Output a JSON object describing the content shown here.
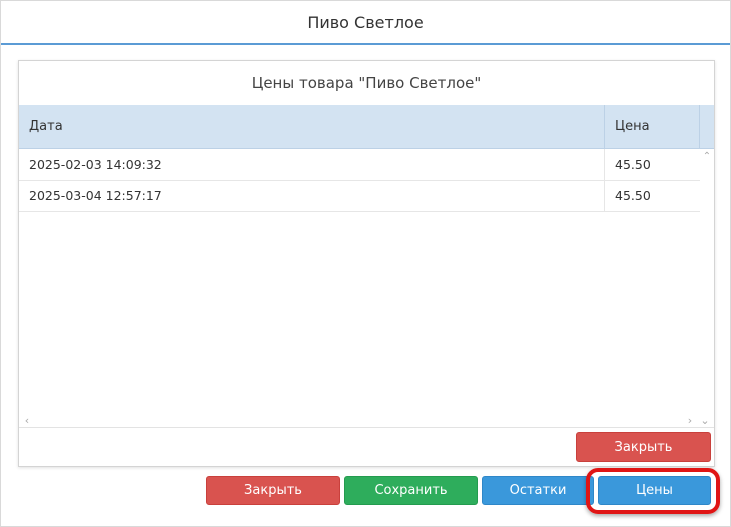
{
  "window": {
    "title": "Пиво Светлое"
  },
  "panel": {
    "title": "Цены товара \"Пиво Светлое\"",
    "columns": [
      "Дата",
      "Цена"
    ],
    "rows": [
      {
        "date": "2025-02-03 14:09:32",
        "price": "45.50"
      },
      {
        "date": "2025-03-04 12:57:17",
        "price": "45.50"
      }
    ],
    "close_label": "Закрыть"
  },
  "footer": {
    "close_label": "Закрыть",
    "save_label": "Сохранить",
    "stock_label": "Остатки",
    "prices_label": "Цены"
  },
  "colors": {
    "accent": "#5b9bd5",
    "header_bg": "#d3e3f2",
    "red": "#d9534f",
    "green": "#2ead5c",
    "blue": "#3a98db",
    "highlight": "#e01515"
  },
  "icons": {
    "scroll_up": "chevron-up-icon",
    "scroll_left": "chevron-left-icon",
    "scroll_right": "chevron-right-icon",
    "scroll_down": "chevron-down-icon"
  }
}
